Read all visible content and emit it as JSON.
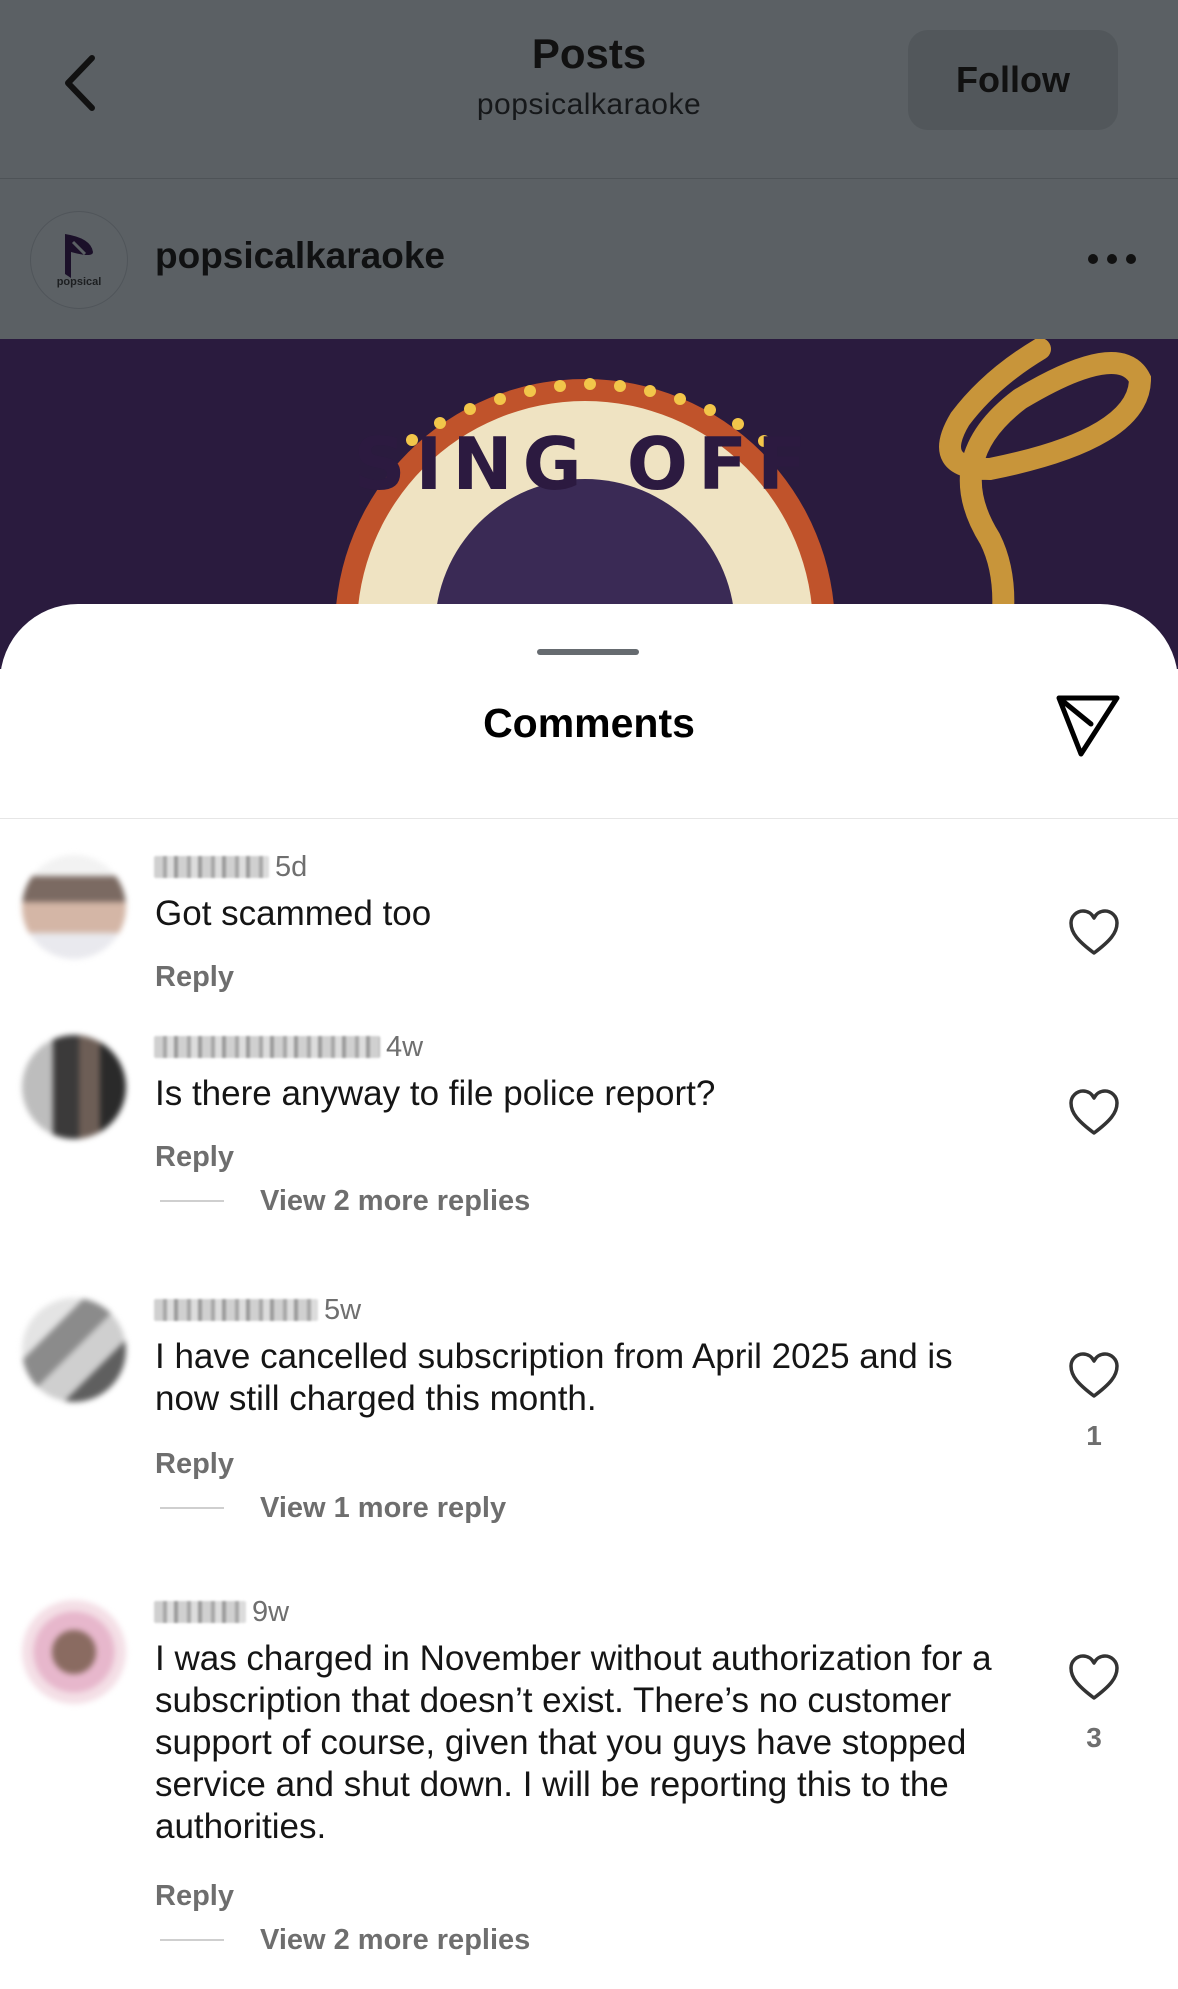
{
  "header": {
    "title": "Posts",
    "subtitle": "popsicalkaraoke",
    "follow_label": "Follow",
    "back_icon": "chevron-left-icon"
  },
  "post": {
    "username": "popsicalkaraoke",
    "avatar_label": "popsical",
    "more_icon": "ellipsis-icon",
    "image_text": "SING OFF"
  },
  "comments_sheet": {
    "title": "Comments",
    "share_icon": "send-icon",
    "reply_label": "Reply",
    "comments": [
      {
        "time": "5d",
        "text": "Got scammed too",
        "likes": "",
        "view_replies": ""
      },
      {
        "time": "4w",
        "text": "Is there anyway to file police report?",
        "likes": "",
        "view_replies": "View 2 more replies"
      },
      {
        "time": "5w",
        "text": "I have cancelled subscription from April 2025 and is now still charged this month.",
        "likes": "1",
        "view_replies": "View 1 more reply"
      },
      {
        "time": "9w",
        "text": "I was charged in November without authorization for a subscription that doesn’t exist. There’s no customer support of course, given that you guys have stopped service and shut down. I will be reporting this to the authorities.",
        "likes": "3",
        "view_replies": "View 2 more replies"
      }
    ]
  },
  "colors": {
    "dim_overlay": "#5b6064",
    "post_bg": "#2a1b3e",
    "accent_gold": "#c8953a"
  }
}
